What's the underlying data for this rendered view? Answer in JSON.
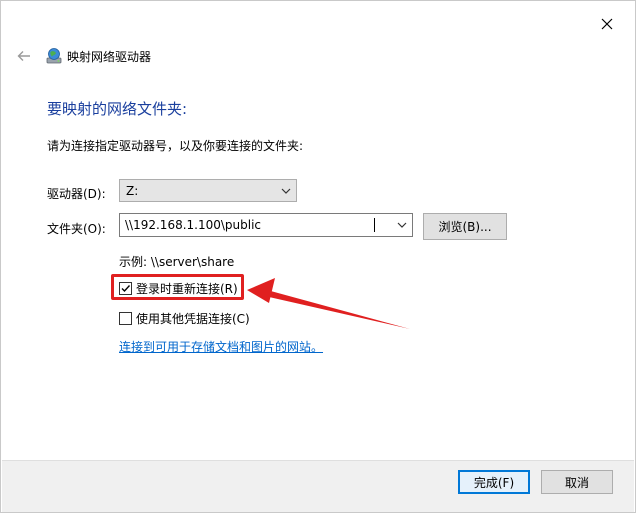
{
  "window": {
    "title": "映射网络驱动器",
    "heading": "要映射的网络文件夹:",
    "instruction": "请为连接指定驱动器号，以及你要连接的文件夹:"
  },
  "drive": {
    "label": "驱动器(D):",
    "selected": "Z:"
  },
  "folder": {
    "label": "文件夹(O):",
    "value": "\\\\192.168.1.100\\public",
    "browse_label": "浏览(B)..."
  },
  "example": "示例: \\\\server\\share",
  "options": {
    "reconnect": {
      "label": "登录时重新连接(R)",
      "checked": true
    },
    "other_credentials": {
      "label": "使用其他凭据连接(C)",
      "checked": false
    }
  },
  "link": "连接到可用于存储文档和图片的网站。",
  "footer": {
    "finish_label": "完成(F)",
    "cancel_label": "取消"
  },
  "colors": {
    "heading": "#1a3f9e",
    "link": "#0066cc",
    "annotation": "#e02020",
    "primary_border": "#0078d7"
  },
  "icons": [
    "close-icon",
    "back-arrow-icon",
    "network-drive-icon",
    "chevron-down-icon",
    "checkmark-icon",
    "annotation-arrow"
  ]
}
